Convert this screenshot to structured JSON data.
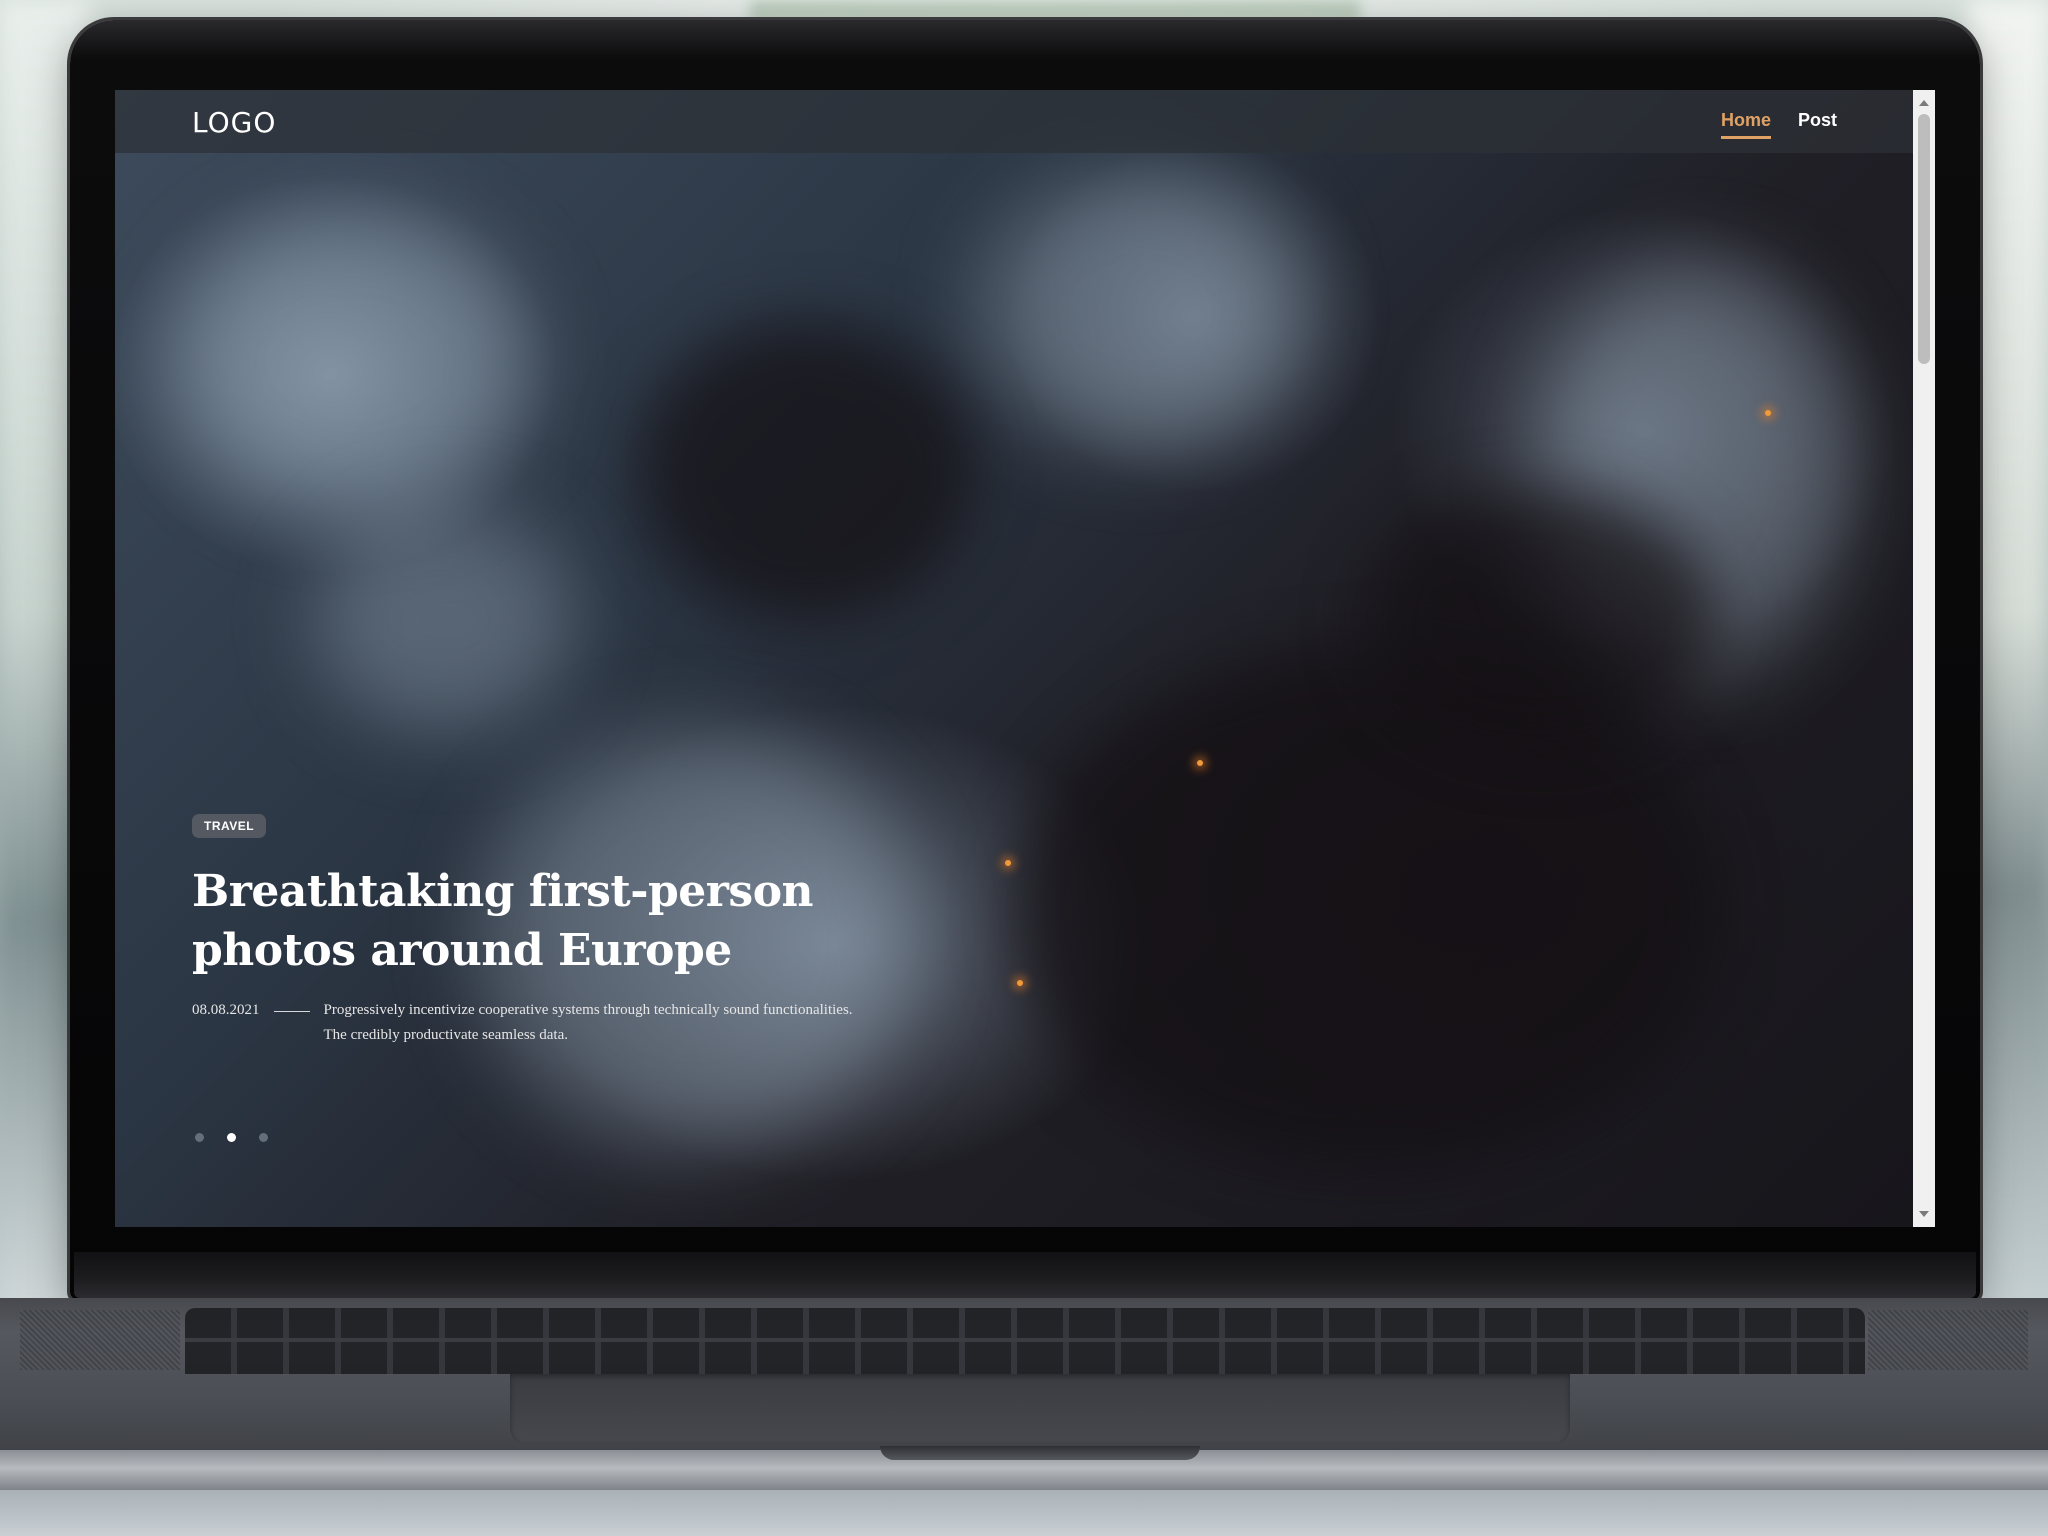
{
  "theme": {
    "accent": "#e0a165"
  },
  "header": {
    "logo": "LOGO",
    "nav": [
      {
        "label": "Home",
        "active": true
      },
      {
        "label": "Post",
        "active": false
      }
    ]
  },
  "hero": {
    "category": "TRAVEL",
    "title": "Breathtaking first-person photos around Europe",
    "date": "08.08.2021",
    "description": "Progressively incentivize cooperative systems through technically sound functionalities. The credibly productivate seamless data.",
    "slides": [
      {
        "active": false
      },
      {
        "active": true
      },
      {
        "active": false
      }
    ]
  },
  "icons": {
    "scroll_up": "scroll-up-arrow-icon",
    "scroll_down": "scroll-down-arrow-icon"
  }
}
